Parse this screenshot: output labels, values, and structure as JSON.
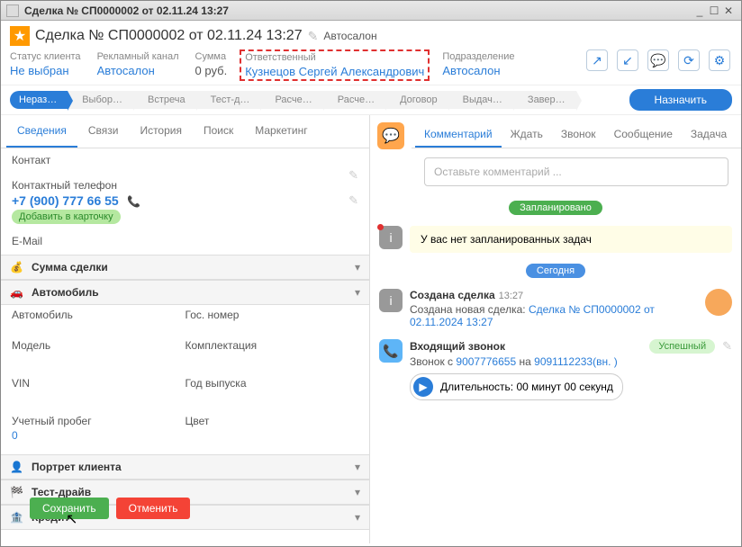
{
  "window": {
    "title": "Сделка № СП0000002 от 02.11.24 13:27"
  },
  "header": {
    "title": "Сделка № СП0000002 от 02.11.24 13:27",
    "category": "Автосалон"
  },
  "info": {
    "status": {
      "label": "Статус клиента",
      "value": "Не выбран"
    },
    "channel": {
      "label": "Рекламный канал",
      "value": "Автосалон"
    },
    "sum": {
      "label": "Сумма",
      "value": "0 руб."
    },
    "responsible": {
      "label": "Ответственный",
      "value": "Кузнецов Сергей Александрович"
    },
    "dept": {
      "label": "Подразделение",
      "value": "Автосалон"
    }
  },
  "stages": [
    "Нераз…",
    "Выбор…",
    "Встреча",
    "Тест-д…",
    "Расче…",
    "Расче…",
    "Договор",
    "Выдач…",
    "Завер…"
  ],
  "assign": "Назначить",
  "left_tabs": [
    "Сведения",
    "Связи",
    "История",
    "Поиск",
    "Маркетинг"
  ],
  "contact": {
    "label": "Контакт"
  },
  "phone": {
    "label": "Контактный телефон",
    "value": "+7 (900) 777 66 55",
    "add": "Добавить в карточку"
  },
  "email": {
    "label": "E-Mail"
  },
  "groups": {
    "sum": "Сумма сделки",
    "auto": "Автомобиль",
    "portrait": "Портрет клиента",
    "testdrive": "Тест-драйв",
    "credit": "Кредит"
  },
  "autofields": {
    "car": {
      "label": "Автомобиль"
    },
    "reg": {
      "label": "Гос. номер"
    },
    "model": {
      "label": "Модель"
    },
    "config": {
      "label": "Комплектация"
    },
    "vin": {
      "label": "VIN"
    },
    "year": {
      "label": "Год выпуска"
    },
    "mileage": {
      "label": "Учетный пробег",
      "value": "0"
    },
    "color": {
      "label": "Цвет"
    }
  },
  "buttons": {
    "save": "Сохранить",
    "cancel": "Отменить"
  },
  "right_tabs": [
    "Комментарий",
    "Ждать",
    "Звонок",
    "Сообщение",
    "Задача"
  ],
  "comment_placeholder": "Оставьте комментарий ...",
  "badges": {
    "planned": "Запланировано",
    "today": "Сегодня"
  },
  "notask": "У вас нет запланированных задач",
  "feed": {
    "created": {
      "title": "Создана сделка",
      "time": "13:27",
      "text": "Создана новая сделка:",
      "link": "Сделка № СП0000002 от 02.11.2024 13:27"
    },
    "call": {
      "title": "Входящий звонок",
      "status": "Успешный",
      "text1": "Звонок с",
      "num1": "9007776655",
      "text2": "на",
      "num2": "9091112233(вн. )",
      "duration": "Длительность: 00 минут 00 секунд"
    }
  }
}
